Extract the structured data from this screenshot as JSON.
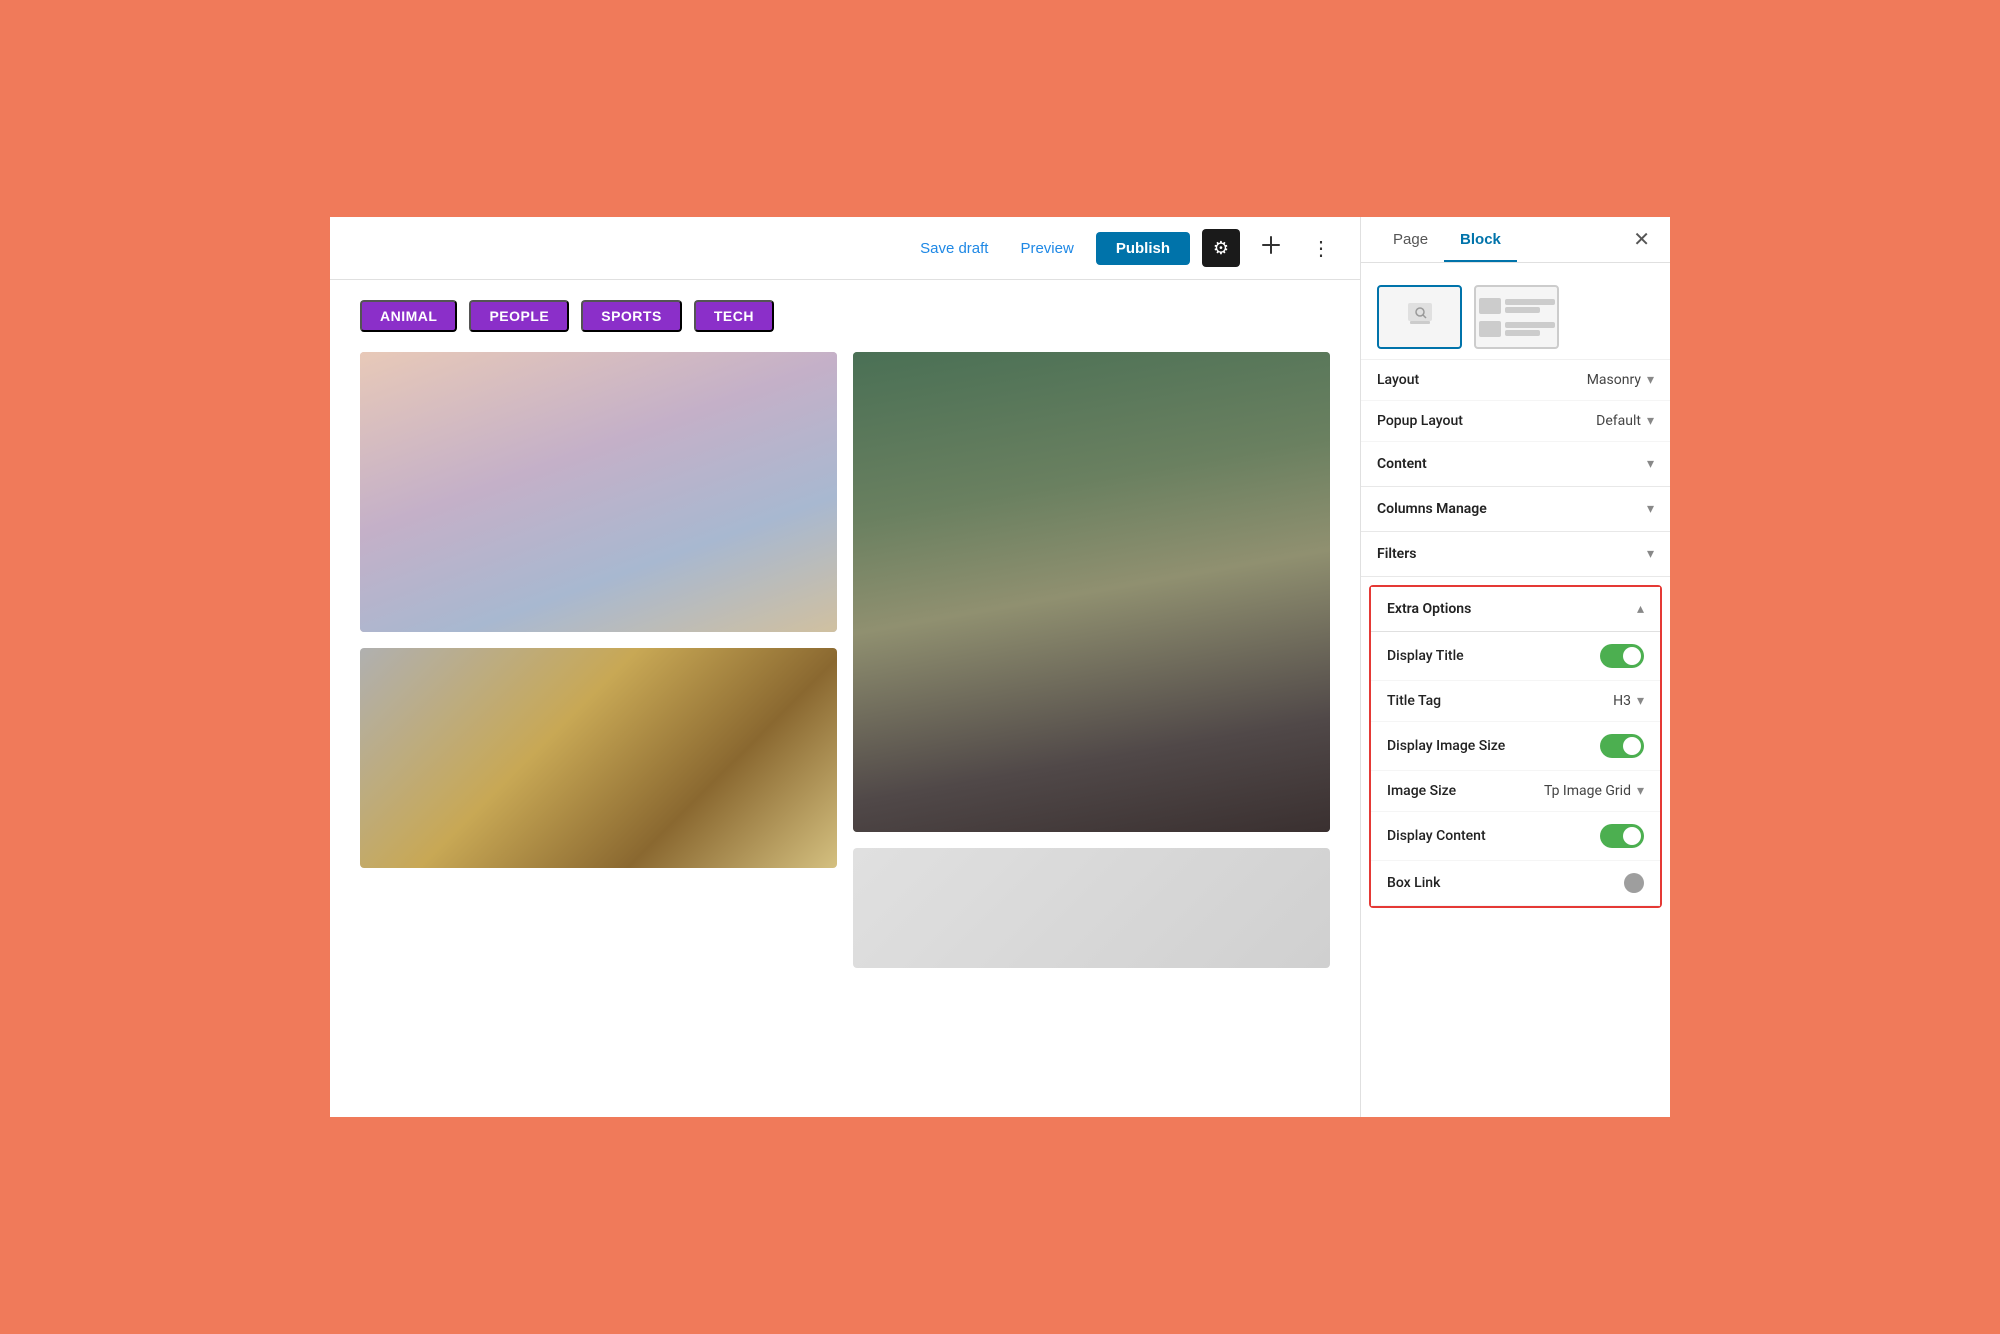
{
  "topbar": {
    "save_draft_label": "Save draft",
    "preview_label": "Preview",
    "publish_label": "Publish"
  },
  "filter_tags": [
    "ANIMAL",
    "PEOPLE",
    "SPORTS",
    "TECH"
  ],
  "sidebar": {
    "tab_page": "Page",
    "tab_block": "Block",
    "layout_label": "Layout",
    "layout_value": "Masonry",
    "popup_layout_label": "Popup Layout",
    "popup_layout_value": "Default",
    "content_label": "Content",
    "columns_manage_label": "Columns Manage",
    "filters_label": "Filters",
    "extra_options": {
      "section_label": "Extra Options",
      "display_title_label": "Display Title",
      "display_title_on": true,
      "title_tag_label": "Title Tag",
      "title_tag_value": "H3",
      "display_image_size_label": "Display Image Size",
      "display_image_size_on": true,
      "image_size_label": "Image Size",
      "image_size_value": "Tp Image Grid",
      "display_content_label": "Display Content",
      "display_content_on": true,
      "box_link_label": "Box Link",
      "box_link_on": false
    }
  }
}
